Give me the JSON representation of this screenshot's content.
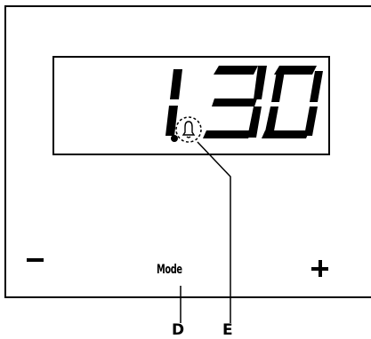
{
  "display": {
    "time": "1.30",
    "digits": [
      "1",
      "3",
      "0"
    ],
    "icon": "bell-icon"
  },
  "controls": {
    "minus": "−",
    "mode": "Mode",
    "plus": "+"
  },
  "callouts": {
    "mode_label": "D",
    "bell_label": "E"
  }
}
